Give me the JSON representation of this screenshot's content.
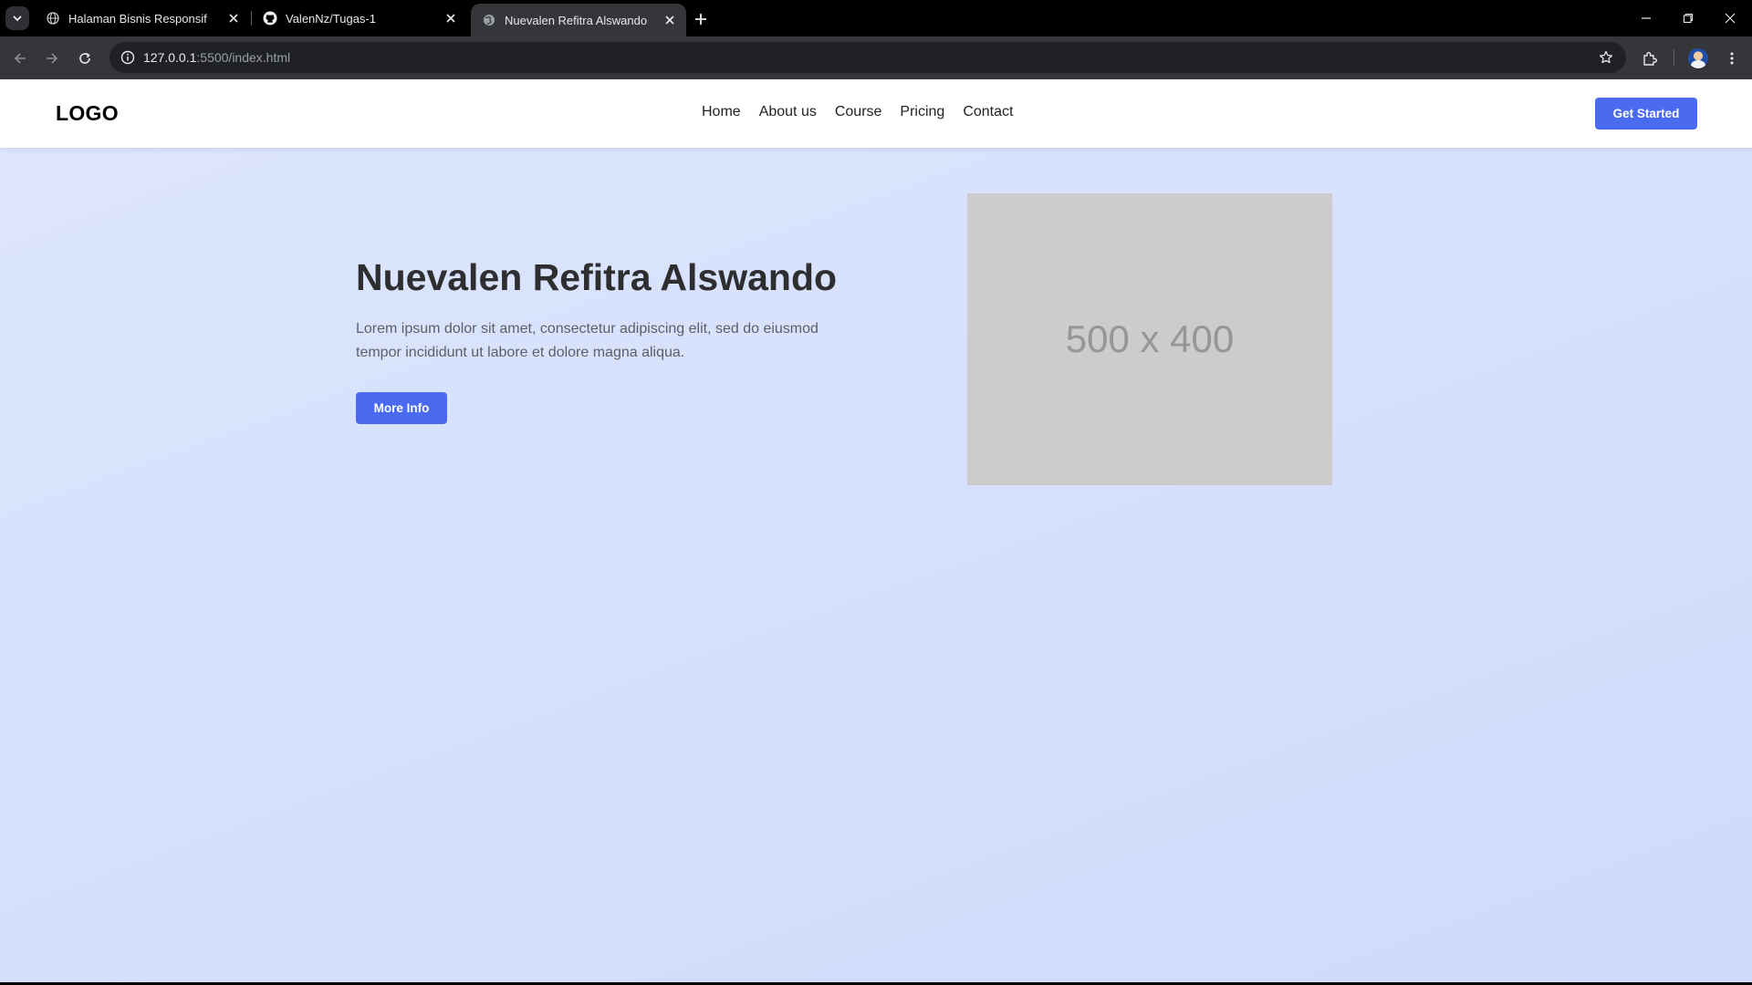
{
  "browser": {
    "tabs": [
      {
        "title": "Halaman Bisnis Responsif",
        "icon": "globe-icon"
      },
      {
        "title": "ValenNz/Tugas-1",
        "icon": "github-icon"
      },
      {
        "title": "Nuevalen Refitra Alswando",
        "icon": "globe-icon",
        "active": true
      }
    ],
    "url_host": "127.0.0.1",
    "url_path": ":5500/index.html"
  },
  "site": {
    "logo": "LOGO",
    "nav": [
      "Home",
      "About us",
      "Course",
      "Pricing",
      "Contact"
    ],
    "cta": "Get Started"
  },
  "hero": {
    "title": "Nuevalen Refitra Alswando",
    "text": "Lorem ipsum dolor sit amet, consectetur adipiscing elit, sed do eiusmod tempor incididunt ut labore et dolore magna aliqua.",
    "button": "More Info",
    "image_label": "500 x 400"
  },
  "colors": {
    "accent": "#4a6bf0",
    "hero_bg": "#d8e2fc",
    "placeholder_bg": "#cccccc"
  }
}
